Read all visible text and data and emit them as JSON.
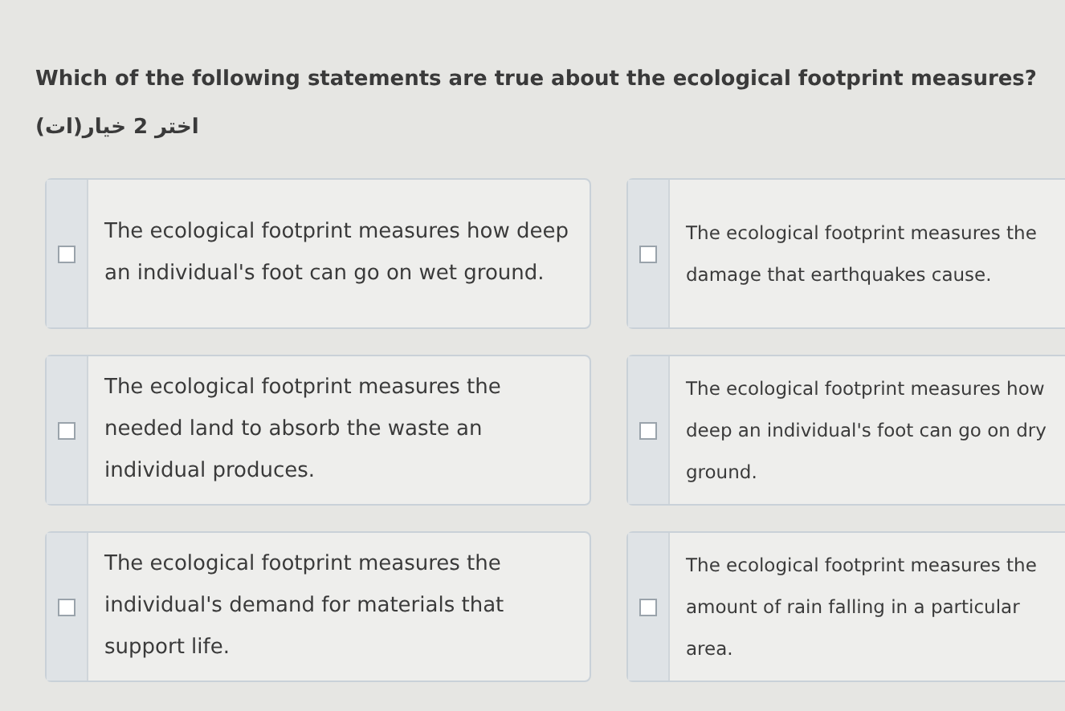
{
  "question": "Which of the following statements are true about the ecological footprint measures?",
  "instruction": "اختر 2 خيار(ات)",
  "options": [
    {
      "text": "The ecological footprint measures how deep an individual's foot can go on wet ground.",
      "checked": false
    },
    {
      "text": "The ecological footprint measures the damage that earthquakes cause.",
      "checked": false
    },
    {
      "text": "The ecological footprint measures the needed land to absorb the waste an individual produces.",
      "checked": false
    },
    {
      "text": "The ecological footprint measures how deep an individual's foot can go on dry ground.",
      "checked": false
    },
    {
      "text": "The ecological footprint measures the individual's demand for materials that support life.",
      "checked": false
    },
    {
      "text": "The ecological footprint measures the amount of rain falling in a particular area.",
      "checked": false
    }
  ]
}
